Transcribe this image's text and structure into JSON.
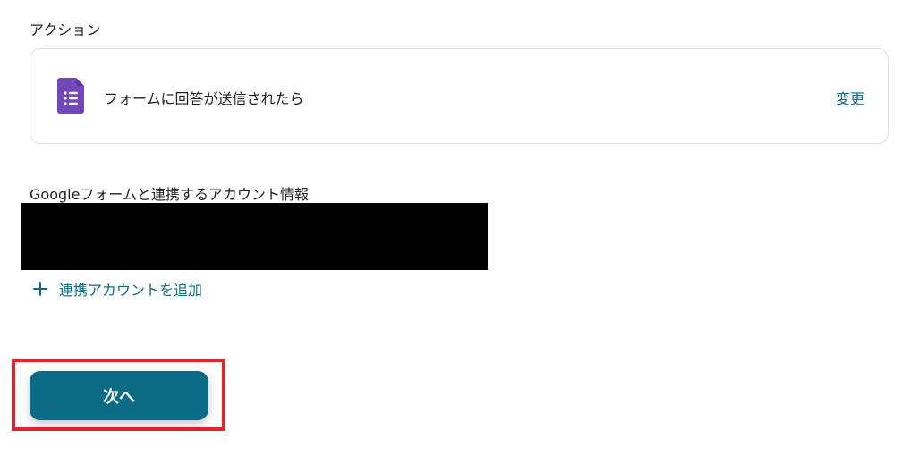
{
  "action_section": {
    "label": "アクション",
    "card": {
      "icon": "google-forms-icon",
      "title": "フォームに回答が送信されたら",
      "change_label": "変更"
    }
  },
  "account_section": {
    "label": "Googleフォームと連携するアカウント情報",
    "add_account_label": "連携アカウントを追加"
  },
  "footer": {
    "next_label": "次へ"
  },
  "colors": {
    "accent": "#0b6b85",
    "forms_purple": "#7248b9",
    "highlight": "#e3242b"
  }
}
